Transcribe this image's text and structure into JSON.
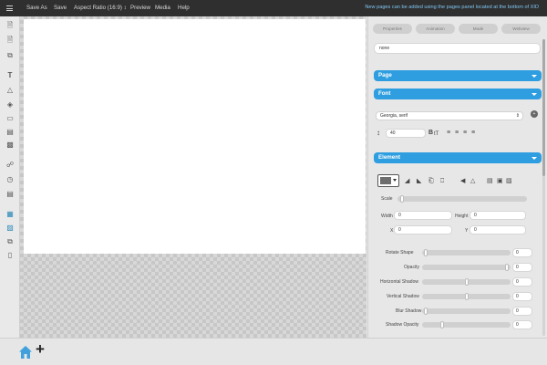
{
  "menubar": {
    "items": [
      "Save As",
      "Save",
      "Aspect Ratio (16:9) ↕",
      "Preview",
      "Media",
      "Help"
    ],
    "notice": "New pages can be added using the pages panel located at the bottom of XID"
  },
  "panel": {
    "tabs": [
      "Properties",
      "Animation",
      "Mode",
      "Webview"
    ],
    "element_name": "none",
    "sections": {
      "page": "Page",
      "font": "Font",
      "element": "Element"
    },
    "font": {
      "family": "Georgia, serif",
      "size": "40",
      "bold": "B",
      "text_transform": "tT"
    },
    "element": {
      "scale_label": "Scale",
      "width_label": "Width",
      "width_value": "0",
      "height_label": "Height",
      "height_value": "0",
      "x_label": "X",
      "x_value": "0",
      "y_label": "Y",
      "y_value": "0",
      "scale_level": 0.02,
      "sliders": [
        {
          "label": "Rotate Shape",
          "value": "0",
          "level": 0.02
        },
        {
          "label": "Opacity",
          "value": "0",
          "level": 0.98
        },
        {
          "label": "Horizontal Shadow",
          "value": "0",
          "level": 0.5
        },
        {
          "label": "Vertical Shadow",
          "value": "0",
          "level": 0.5
        },
        {
          "label": "Blur Shadow",
          "value": "0",
          "level": 0.02
        },
        {
          "label": "Shadow Opacity",
          "value": "0",
          "level": 0.22
        }
      ]
    }
  },
  "colors": {
    "accent": "#2e9ee0",
    "notice": "#7fc6f2",
    "topbar": "#2f2f2f",
    "swatch": "#6e6e6e"
  },
  "icons": {
    "left_toolbar": [
      "add-page-icon",
      "add-page-icon",
      "duplicate-icon",
      "text-icon",
      "shape-icon",
      "fill-icon",
      "comment-icon",
      "library-icon",
      "archive-icon",
      "link-icon",
      "timer-icon",
      "document-icon",
      "image-icon",
      "gallery-icon",
      "copy-icon",
      "trash-icon"
    ],
    "bottom": [
      "home-icon",
      "plus-icon"
    ]
  }
}
